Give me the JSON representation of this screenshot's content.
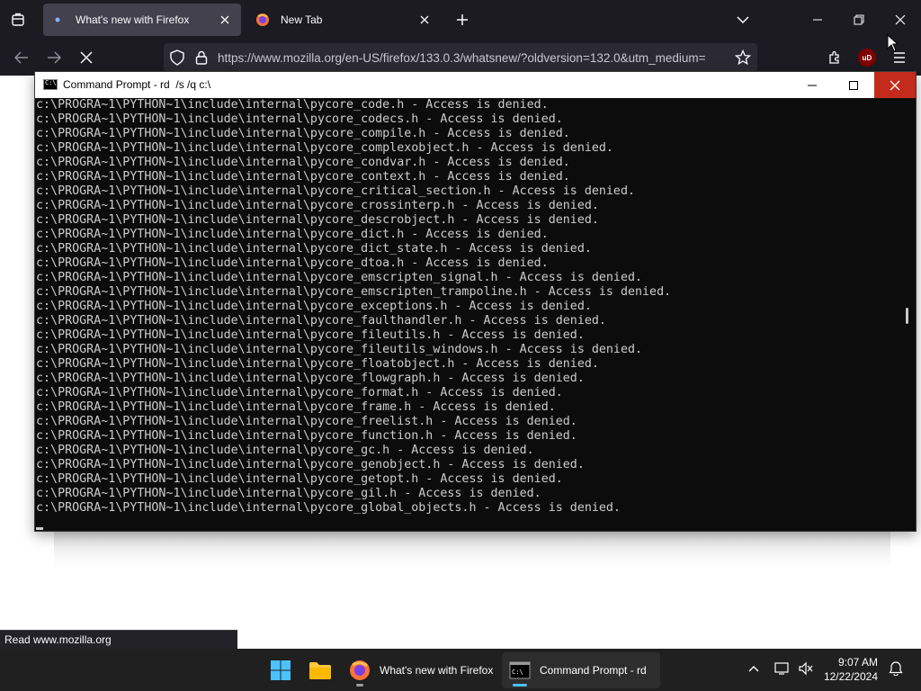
{
  "colors": {
    "browser_bg": "#1c1b22",
    "active_tab": "#42414d",
    "urlbar": "#2b2a33",
    "console_bg": "#0c0c0c",
    "console_text": "#cccccc",
    "close_red": "#c42b1c",
    "taskbar": "#202020",
    "firefox_accent": "#ff7139"
  },
  "browser": {
    "tabs": [
      {
        "label": "What's new with Firefox",
        "icon": "loading-dot-icon",
        "active": true
      },
      {
        "label": "New Tab",
        "icon": "firefox-icon",
        "active": false
      }
    ],
    "url": "https://www.mozilla.org/en-US/firefox/133.0.3/whatsnew/?oldversion=132.0&utm_medium=",
    "extension_badge": "uD",
    "status_text": "Read www.mozilla.org"
  },
  "cmd": {
    "title": "Command Prompt - rd  /s /q c:\\",
    "lines": [
      "c:\\PROGRA~1\\PYTHON~1\\include\\internal\\pycore_code.h - Access is denied.",
      "c:\\PROGRA~1\\PYTHON~1\\include\\internal\\pycore_codecs.h - Access is denied.",
      "c:\\PROGRA~1\\PYTHON~1\\include\\internal\\pycore_compile.h - Access is denied.",
      "c:\\PROGRA~1\\PYTHON~1\\include\\internal\\pycore_complexobject.h - Access is denied.",
      "c:\\PROGRA~1\\PYTHON~1\\include\\internal\\pycore_condvar.h - Access is denied.",
      "c:\\PROGRA~1\\PYTHON~1\\include\\internal\\pycore_context.h - Access is denied.",
      "c:\\PROGRA~1\\PYTHON~1\\include\\internal\\pycore_critical_section.h - Access is denied.",
      "c:\\PROGRA~1\\PYTHON~1\\include\\internal\\pycore_crossinterp.h - Access is denied.",
      "c:\\PROGRA~1\\PYTHON~1\\include\\internal\\pycore_descrobject.h - Access is denied.",
      "c:\\PROGRA~1\\PYTHON~1\\include\\internal\\pycore_dict.h - Access is denied.",
      "c:\\PROGRA~1\\PYTHON~1\\include\\internal\\pycore_dict_state.h - Access is denied.",
      "c:\\PROGRA~1\\PYTHON~1\\include\\internal\\pycore_dtoa.h - Access is denied.",
      "c:\\PROGRA~1\\PYTHON~1\\include\\internal\\pycore_emscripten_signal.h - Access is denied.",
      "c:\\PROGRA~1\\PYTHON~1\\include\\internal\\pycore_emscripten_trampoline.h - Access is denied.",
      "c:\\PROGRA~1\\PYTHON~1\\include\\internal\\pycore_exceptions.h - Access is denied.",
      "c:\\PROGRA~1\\PYTHON~1\\include\\internal\\pycore_faulthandler.h - Access is denied.",
      "c:\\PROGRA~1\\PYTHON~1\\include\\internal\\pycore_fileutils.h - Access is denied.",
      "c:\\PROGRA~1\\PYTHON~1\\include\\internal\\pycore_fileutils_windows.h - Access is denied.",
      "c:\\PROGRA~1\\PYTHON~1\\include\\internal\\pycore_floatobject.h - Access is denied.",
      "c:\\PROGRA~1\\PYTHON~1\\include\\internal\\pycore_flowgraph.h - Access is denied.",
      "c:\\PROGRA~1\\PYTHON~1\\include\\internal\\pycore_format.h - Access is denied.",
      "c:\\PROGRA~1\\PYTHON~1\\include\\internal\\pycore_frame.h - Access is denied.",
      "c:\\PROGRA~1\\PYTHON~1\\include\\internal\\pycore_freelist.h - Access is denied.",
      "c:\\PROGRA~1\\PYTHON~1\\include\\internal\\pycore_function.h - Access is denied.",
      "c:\\PROGRA~1\\PYTHON~1\\include\\internal\\pycore_gc.h - Access is denied.",
      "c:\\PROGRA~1\\PYTHON~1\\include\\internal\\pycore_genobject.h - Access is denied.",
      "c:\\PROGRA~1\\PYTHON~1\\include\\internal\\pycore_getopt.h - Access is denied.",
      "c:\\PROGRA~1\\PYTHON~1\\include\\internal\\pycore_gil.h - Access is denied.",
      "c:\\PROGRA~1\\PYTHON~1\\include\\internal\\pycore_global_objects.h - Access is denied."
    ]
  },
  "taskbar": {
    "firefox_label": "What's new with Firefox",
    "cmd_label": "Command Prompt - rd",
    "time": "9:07 AM",
    "date": "12/22/2024"
  }
}
